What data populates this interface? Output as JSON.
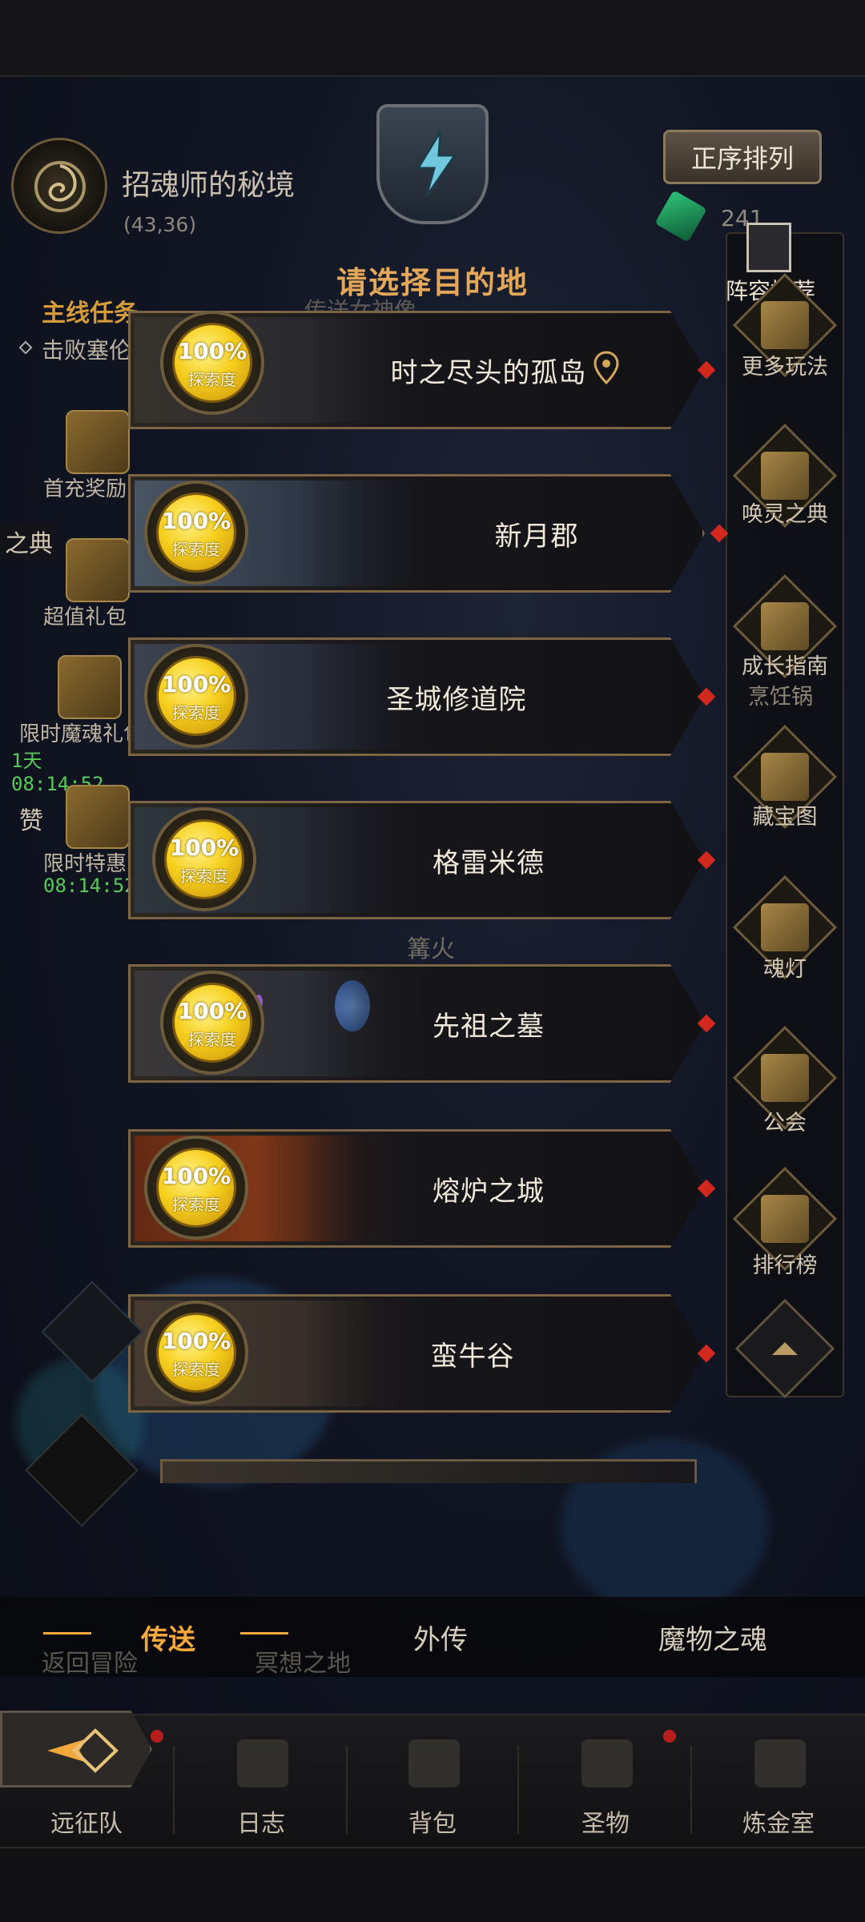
{
  "header": {
    "region_name": "招魂师的秘境",
    "coordinates": "(43,36)",
    "dialog_title": "请选择目的地",
    "sort_button": "正序排列",
    "currency_value": "241",
    "bg_hint_top": "传送女神像",
    "bg_hint_mid": "篝火"
  },
  "quest": {
    "title": "主线任务",
    "text": "击败塞伦"
  },
  "left_items": [
    {
      "label": "首充奖励"
    },
    {
      "label": "超值礼包"
    },
    {
      "label": "限时魔魂礼包",
      "timer": "1天 08:14:52"
    },
    {
      "label": "限时特惠",
      "timer": "08:14:52"
    }
  ],
  "left_fragments": {
    "a": "之典",
    "b": "赞"
  },
  "right_items": [
    {
      "label": "阵容推荐"
    },
    {
      "label": "更多玩法"
    },
    {
      "label": "唤灵之典"
    },
    {
      "label": "成长指南"
    },
    {
      "label": "烹饪锅"
    },
    {
      "label": "藏宝图"
    },
    {
      "label": "魂灯"
    },
    {
      "label": "公会"
    },
    {
      "label": "排行榜"
    }
  ],
  "destinations": [
    {
      "name": "时之尽头的孤岛",
      "progress": "100%",
      "progress_label": "探索度",
      "current": true
    },
    {
      "name": "新月郡",
      "progress": "100%",
      "progress_label": "探索度"
    },
    {
      "name": "圣城修道院",
      "progress": "100%",
      "progress_label": "探索度"
    },
    {
      "name": "格雷米德",
      "progress": "100%",
      "progress_label": "探索度"
    },
    {
      "name": "先祖之墓",
      "progress": "100%",
      "progress_label": "探索度"
    },
    {
      "name": "熔炉之城",
      "progress": "100%",
      "progress_label": "探索度"
    },
    {
      "name": "蛮牛谷",
      "progress": "100%",
      "progress_label": "探索度"
    }
  ],
  "tabs": [
    {
      "label": "传送",
      "active": true
    },
    {
      "label": "外传"
    },
    {
      "label": "魔物之魂"
    }
  ],
  "tab_underlay": {
    "left": "返回冒险",
    "mid": "冥想之地"
  },
  "nav": [
    {
      "label": "远征队"
    },
    {
      "label": "日志"
    },
    {
      "label": "背包"
    },
    {
      "label": "圣物"
    },
    {
      "label": "炼金室"
    }
  ],
  "colors": {
    "accent_gold": "#e3a75a",
    "active_tab": "#f2a83c",
    "timer_green": "#58c95a",
    "alert_red": "#d3281e"
  }
}
